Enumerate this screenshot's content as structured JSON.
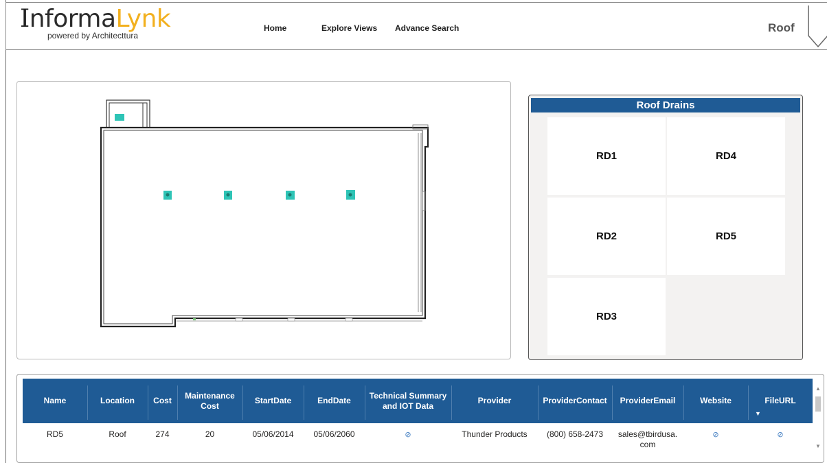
{
  "header": {
    "logo_part1": "I",
    "logo_part2": "nforma",
    "logo_part3": "Lynk",
    "logo_sub": "powered by Architecttura",
    "nav": [
      "Home",
      "Explore Views",
      "Advance Search"
    ],
    "page_label": "Roof"
  },
  "drains": {
    "title": "Roof Drains",
    "items": [
      "RD1",
      "RD4",
      "RD2",
      "RD5",
      "RD3"
    ]
  },
  "table": {
    "columns": [
      "Name",
      "Location",
      "Cost",
      "Maintenance Cost",
      "StartDate",
      "EndDate",
      "Technical Summary and IOT Data",
      "Provider",
      "ProviderContact",
      "ProviderEmail",
      "Website",
      "FileURL"
    ],
    "rows": [
      {
        "name": "RD5",
        "location": "Roof",
        "cost": "274",
        "maintenance_cost": "20",
        "start_date": "05/06/2014",
        "end_date": "05/06/2060",
        "tech_icon": "link-icon",
        "provider": "Thunder Products",
        "provider_contact": "(800) 658-2473",
        "provider_email_1": "sales@tbirdusa.",
        "provider_email_2": "com",
        "website_icon": "link-icon",
        "fileurl_icon": "link-icon"
      }
    ]
  },
  "colors": {
    "brand_blue": "#1f5b95",
    "logo_yellow": "#f2b01e",
    "drain_marker": "#2ec4b6"
  }
}
